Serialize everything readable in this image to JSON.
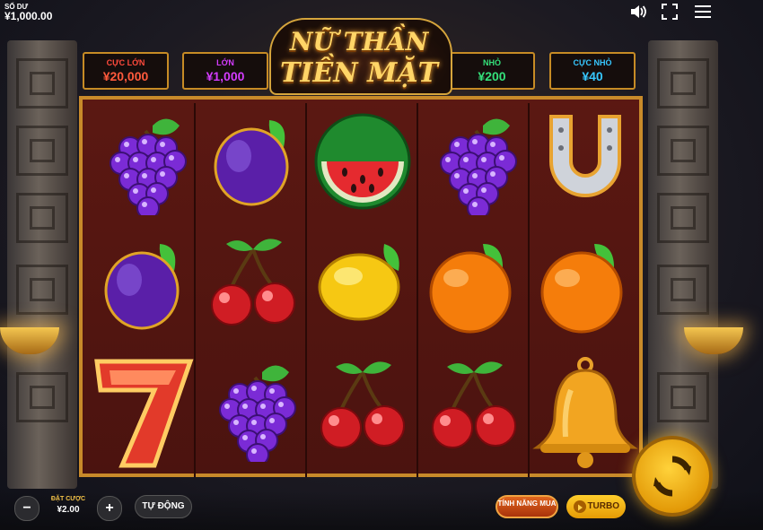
{
  "balance": {
    "label": "SỐ DƯ",
    "value": "¥1,000.00"
  },
  "top_icons": [
    "speaker-icon",
    "fullscreen-icon",
    "menu-icon"
  ],
  "logo": {
    "line1": "NỮ THẦN",
    "line2": "TIỀN MẶT"
  },
  "jackpots": [
    {
      "name": "CỰC LỚN",
      "value": "¥20,000",
      "color": "#ff4a3c"
    },
    {
      "name": "LỚN",
      "value": "¥1,000",
      "color": "#d43cff"
    },
    {
      "name": "NHỎ",
      "value": "¥200",
      "color": "#34e07a"
    },
    {
      "name": "CỰC NHỎ",
      "value": "¥40",
      "color": "#37c7ff"
    }
  ],
  "reels": [
    [
      "grapes",
      "plum",
      "seven"
    ],
    [
      "plum",
      "cherries",
      "grapes"
    ],
    [
      "watermelon",
      "lemon",
      "cherries"
    ],
    [
      "grapes",
      "orange",
      "cherries"
    ],
    [
      "horseshoe",
      "orange",
      "bell"
    ]
  ],
  "controls": {
    "minus": "−",
    "plus": "+",
    "bet_label": "ĐẶT CƯỢC",
    "bet_value": "¥2.00",
    "auto_label": "TỰ ĐỘNG",
    "buy_feature_label": "TÍNH NĂNG MUA",
    "turbo_label": "TURBO"
  },
  "colors": {
    "accent": "#f4b51c",
    "reel_bg": "#5b1812",
    "frame_gold": "#c88a2a"
  }
}
